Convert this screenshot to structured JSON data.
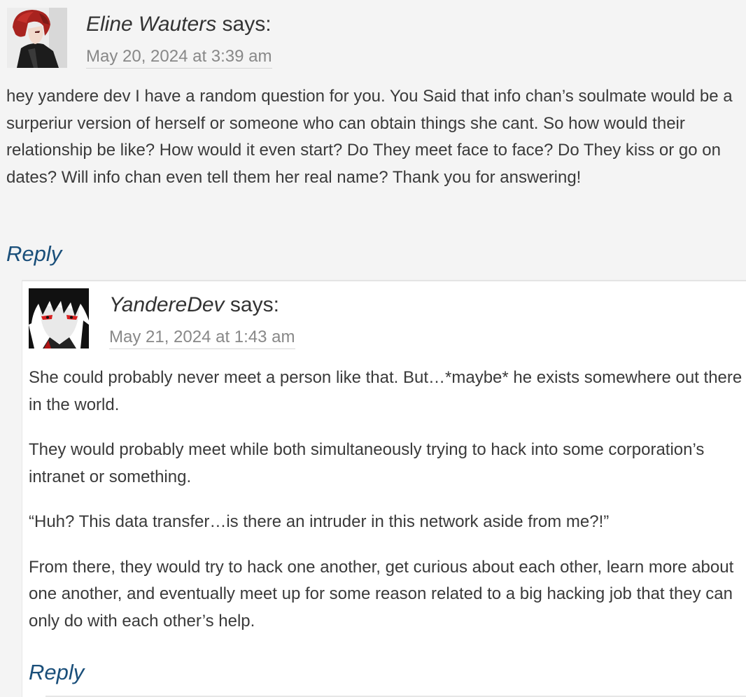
{
  "comments": [
    {
      "author": "Eline Wauters",
      "says": "says:",
      "date": "May 20, 2024 at 3:39 am",
      "paragraphs": [
        "hey yandere dev I have a random question for you. You Said that info chan’s soulmate would be a surperiur version of herself or someone who can obtain things she cant. So how would their relationship be like? How would it even start? Do They meet face to face? Do They kiss or go on dates? Will info chan even tell them her real name? Thank you for answering!"
      ],
      "reply_label": "Reply",
      "avatar_icon": "red-haired-anime-character-avatar"
    },
    {
      "author": "YandereDev",
      "says": "says:",
      "date": "May 21, 2024 at 1:43 am",
      "paragraphs": [
        "She could probably never meet a person like that. But…*maybe* he exists somewhere out there in the world.",
        "They would probably meet while both simultaneously trying to hack into some corporation’s intranet or something.",
        "“Huh? This data transfer…is there an intruder in this network aside from me?!”",
        "From there, they would try to hack one another, get curious about each other, learn more about one another, and eventually meet up for some reason related to a big hacking job that they can only do with each other’s help."
      ],
      "reply_label": "Reply",
      "avatar_icon": "black-haired-red-eyed-anime-avatar"
    }
  ],
  "colors": {
    "background": "#f4f4f4",
    "nested_background": "#ffffff",
    "text": "#3a3a3a",
    "date": "#888888",
    "reply_link": "#1a4f7a"
  }
}
